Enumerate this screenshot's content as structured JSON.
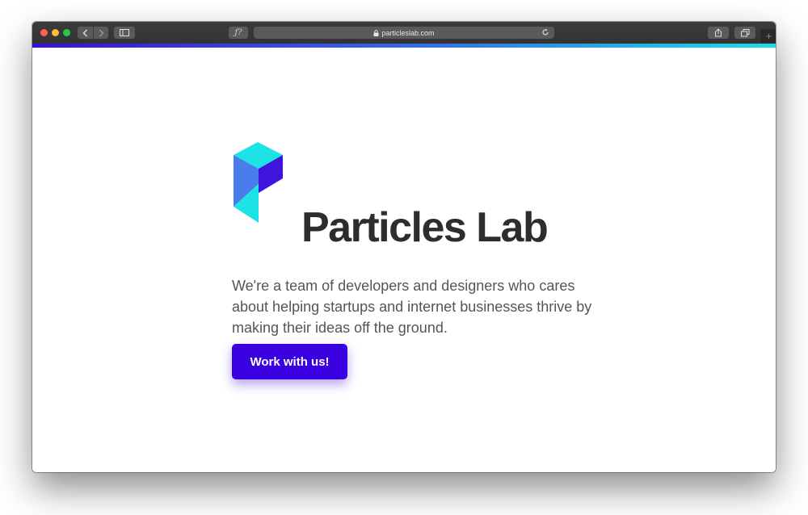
{
  "browser": {
    "url": "particleslab.com",
    "reader_label": "ƒ?",
    "new_tab_label": "+",
    "icons": {
      "back": "chevron-left-icon",
      "forward": "chevron-right-icon",
      "sidebar": "sidebar-icon",
      "lock": "lock-icon",
      "reload": "reload-icon",
      "share": "share-icon",
      "tabs": "tabs-overview-icon"
    }
  },
  "hero": {
    "brand_name": "Particles Lab",
    "tagline": "We're a team of developers and designers who cares about helping startups and internet businesses thrive by making their ideas off the ground.",
    "cta_label": "Work with us!"
  },
  "colors": {
    "cta": "#3b00e0",
    "accent_start": "#3b0fd6",
    "accent_end": "#19dde6",
    "logo_cyan": "#1de3e6",
    "logo_blue": "#4a7cec",
    "logo_violet": "#3f14dc",
    "brand_text": "#2d2d2d"
  }
}
